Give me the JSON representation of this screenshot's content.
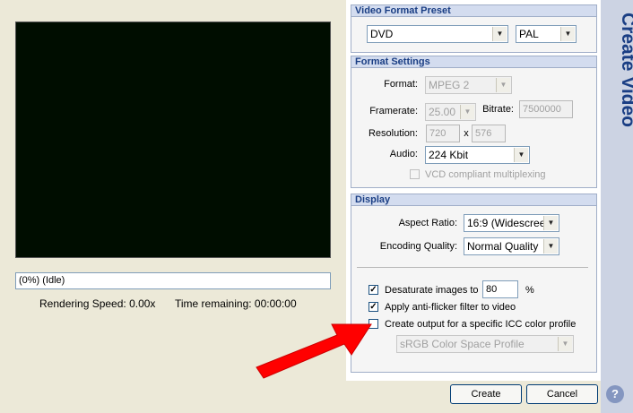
{
  "preview": {
    "progress_text": "(0%) (Idle)",
    "rendering_speed": "Rendering Speed: 0.00x",
    "time_remaining": "Time remaining: 00:00:00"
  },
  "video_format_preset": {
    "header": "Video Format Preset",
    "format_value": "DVD",
    "standard_value": "PAL"
  },
  "format_settings": {
    "header": "Format Settings",
    "format_label": "Format:",
    "format_value": "MPEG 2",
    "framerate_label": "Framerate:",
    "framerate_value": "25.00",
    "bitrate_label": "Bitrate:",
    "bitrate_value": "7500000",
    "resolution_label": "Resolution:",
    "resolution_width": "720",
    "resolution_x": "x",
    "resolution_height": "576",
    "audio_label": "Audio:",
    "audio_value": "224 Kbit",
    "vcd_label": "VCD compliant multiplexing",
    "vcd_checked": false
  },
  "display": {
    "header": "Display",
    "aspect_label": "Aspect Ratio:",
    "aspect_value": "16:9 (Widescree",
    "quality_label": "Encoding Quality:",
    "quality_value": "Normal Quality",
    "desaturate_label": "Desaturate images to",
    "desaturate_checked": true,
    "desaturate_value": "80",
    "desaturate_unit": "%",
    "antiflicker_label": "Apply anti-flicker filter to video",
    "antiflicker_checked": true,
    "icc_label": "Create output for a specific ICC color profile",
    "icc_checked": false,
    "icc_profile_value": "sRGB Color Space Profile"
  },
  "buttons": {
    "create": "Create",
    "cancel": "Cancel"
  },
  "side": {
    "title": "Create Video",
    "help": "?"
  },
  "colors": {
    "side_strip": "#ccd3e3",
    "side_title": "#1a3e84",
    "arrow": "#ff0000"
  },
  "icons": {
    "dropdown": "chevron-down-icon",
    "help": "help-icon",
    "arrow": "red-arrow-annotation"
  }
}
